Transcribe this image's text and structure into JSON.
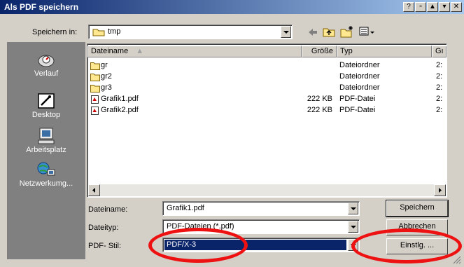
{
  "window": {
    "title": "Als PDF speichern"
  },
  "lookin": {
    "label": "Speichern in:",
    "value": "tmp"
  },
  "places": [
    {
      "label": "Verlauf",
      "icon": "history-icon"
    },
    {
      "label": "Desktop",
      "icon": "desktop-icon"
    },
    {
      "label": "Arbeitsplatz",
      "icon": "my-computer-icon"
    },
    {
      "label": "Netzwerkumg...",
      "icon": "network-icon"
    }
  ],
  "columns": {
    "name": "Dateiname",
    "size": "Größe",
    "type": "Typ",
    "date": "Gı"
  },
  "files": [
    {
      "name": "gr",
      "size": "",
      "type": "Dateiordner",
      "date": "2:",
      "icon": "folder-icon"
    },
    {
      "name": "gr2",
      "size": "",
      "type": "Dateiordner",
      "date": "2:",
      "icon": "folder-icon"
    },
    {
      "name": "gr3",
      "size": "",
      "type": "Dateiordner",
      "date": "2:",
      "icon": "folder-icon"
    },
    {
      "name": "Grafik1.pdf",
      "size": "222 KB",
      "type": "PDF-Datei",
      "date": "2:",
      "icon": "pdf-file-icon"
    },
    {
      "name": "Grafik2.pdf",
      "size": "222 KB",
      "type": "PDF-Datei",
      "date": "2:",
      "icon": "pdf-file-icon"
    }
  ],
  "form": {
    "filename_label": "Dateiname:",
    "filename_value": "Grafik1.pdf",
    "filetype_label": "Dateityp:",
    "filetype_value": "PDF-Dateien (*.pdf)",
    "style_label": "PDF- Stil:",
    "style_value": "PDF/X-3"
  },
  "buttons": {
    "save": "Speichern",
    "cancel": "Abbrechen",
    "settings": "Einstlg. ..."
  },
  "colors": {
    "title_start": "#0a246a",
    "title_end": "#a6caf0",
    "places_bg": "#808080",
    "selection": "#0a246a",
    "highlight_ring": "#e11111"
  }
}
